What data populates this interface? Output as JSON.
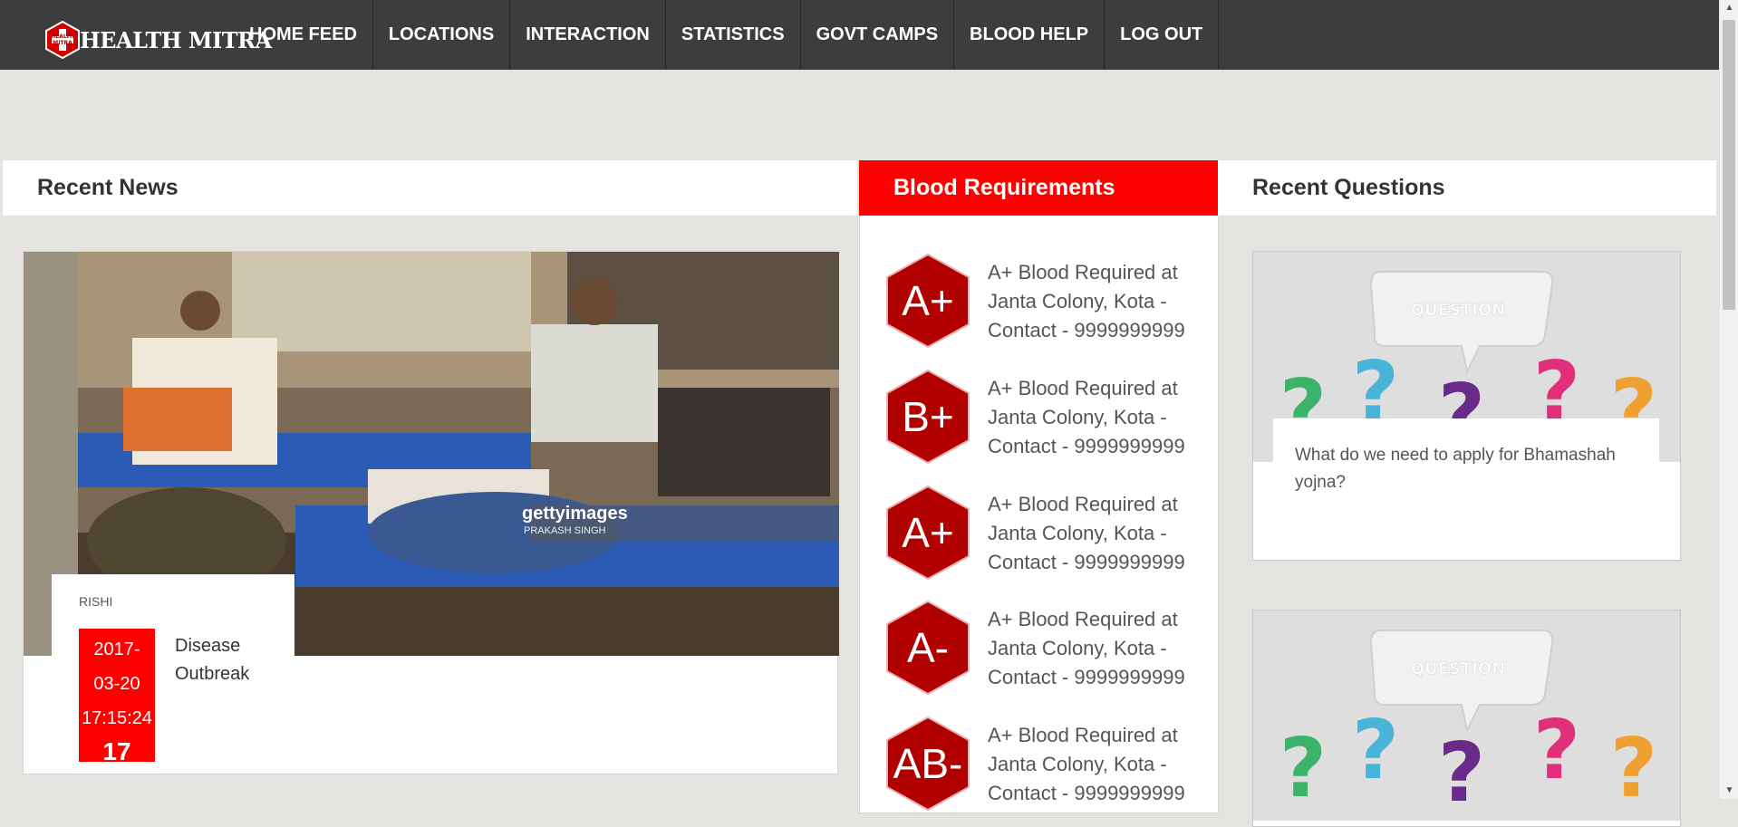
{
  "app": {
    "brand": "HEALTH MITRA",
    "brand_mark_text": "HEALTH MITRA"
  },
  "nav": {
    "items": [
      {
        "label": "HOME FEED"
      },
      {
        "label": "LOCATIONS"
      },
      {
        "label": "INTERACTION"
      },
      {
        "label": "STATISTICS"
      },
      {
        "label": "GOVT CAMPS"
      },
      {
        "label": "BLOOD HELP"
      },
      {
        "label": "LOG OUT"
      }
    ]
  },
  "sections": {
    "news_title": "Recent News",
    "blood_title": "Blood Requirements",
    "questions_title": "Recent Questions"
  },
  "news": [
    {
      "author": "RISHI",
      "date": "2017-03-20 17:15:24",
      "date_line1": "2017-",
      "date_line2": "03-20",
      "date_line3": "17:15:24",
      "day": "17",
      "title": "Disease Outbreak",
      "photo_watermark": "gettyimages",
      "photo_credit": "PRAKASH SINGH"
    }
  ],
  "blood": [
    {
      "group": "A+",
      "text": "A+ Blood Required at Janta Colony, Kota - Contact - 9999999999"
    },
    {
      "group": "B+",
      "text": "A+ Blood Required at Janta Colony, Kota - Contact - 9999999999"
    },
    {
      "group": "A+",
      "text": "A+ Blood Required at Janta Colony, Kota - Contact - 9999999999"
    },
    {
      "group": "A-",
      "text": "A+ Blood Required at Janta Colony, Kota - Contact - 9999999999"
    },
    {
      "group": "AB-",
      "text": "A+ Blood Required at Janta Colony, Kota - Contact - 9999999999"
    }
  ],
  "questions": [
    {
      "image_label": "QUESTION",
      "text": "What do we need to apply for Bhamashah yojna?"
    },
    {
      "image_label": "QUESTION",
      "text": ""
    }
  ],
  "colors": {
    "navbar": "#3d3d3d",
    "accent_red": "#ff0000",
    "hex_red": "#b00000",
    "page_bg": "#e4e3e0"
  }
}
